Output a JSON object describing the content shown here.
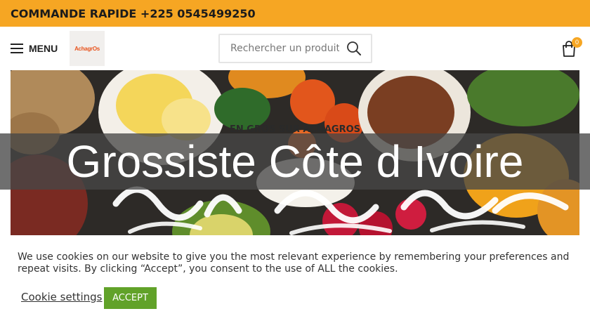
{
  "topbar": {
    "text": "COMMANDE RAPIDE +225 0545499250",
    "bg_color": "#f6a623"
  },
  "header": {
    "menu_label": "MENU",
    "menu_icon": "hamburger-icon",
    "logo_text": "AchagrOs",
    "search": {
      "placeholder": "Rechercher un produits",
      "icon": "search-icon"
    },
    "cart": {
      "icon": "shopping-bag-icon",
      "count": "0"
    }
  },
  "hero": {
    "kicker": "EN GROS SUR ACHAGROS",
    "title": "Grossiste Côte d Ivoire",
    "overlay_color": "#464646"
  },
  "cookie_banner": {
    "message": "We use cookies on our website to give you the most relevant experience by remembering your preferences and repeat visits. By clicking “Accept”, you consent to the use of ALL the cookies.",
    "settings_label": "Cookie settings",
    "accept_label": "ACCEPT",
    "accept_color": "#61a229"
  }
}
